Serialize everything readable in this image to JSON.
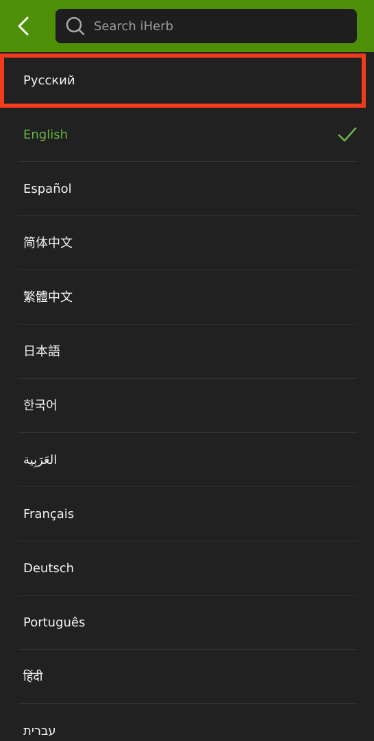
{
  "header": {
    "back_icon": "chevron-left-icon",
    "search": {
      "placeholder": "Search iHerb",
      "value": "",
      "icon": "search-icon"
    },
    "background_color": "#4d8f06"
  },
  "languages": {
    "selected": "English",
    "highlight_color": "#f23b1b",
    "selected_color": "#6ab344",
    "items": [
      {
        "label": "Русский"
      },
      {
        "label": "English"
      },
      {
        "label": "Español"
      },
      {
        "label": "简体中文"
      },
      {
        "label": "繁體中文"
      },
      {
        "label": "日本語"
      },
      {
        "label": "한국어"
      },
      {
        "label": "العَرَبِية"
      },
      {
        "label": "Français"
      },
      {
        "label": "Deutsch"
      },
      {
        "label": "Português"
      },
      {
        "label": "हिंदी"
      },
      {
        "label": "עברית"
      }
    ]
  }
}
